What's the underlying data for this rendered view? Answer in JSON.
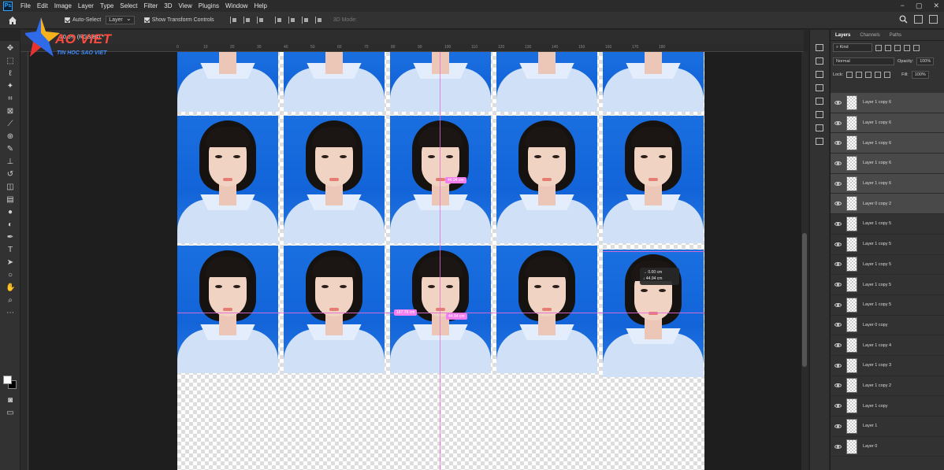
{
  "app": {
    "logo_letters": "Ps"
  },
  "menu": [
    "File",
    "Edit",
    "Image",
    "Layer",
    "Type",
    "Select",
    "Filter",
    "3D",
    "View",
    "Plugins",
    "Window",
    "Help"
  ],
  "window_controls": [
    "−",
    "▢",
    "✕"
  ],
  "options": {
    "auto_select_label": "Auto-Select",
    "auto_select_target": "Layer",
    "show_transform_label": "Show Transform Controls",
    "mode_3d_label": "3D Mode:"
  },
  "document": {
    "tab_title": "20.6% (RGB/8#) *"
  },
  "ruler_labels": [
    "0",
    "10",
    "20",
    "30",
    "40",
    "50",
    "60",
    "70",
    "80",
    "90",
    "100",
    "110",
    "120",
    "130",
    "140",
    "150",
    "160",
    "170",
    "180"
  ],
  "measurements": {
    "top": "44.94 cm",
    "left": "167.79 cm",
    "mid": "44.94 cm",
    "tooltip_dx": "0.00 cm",
    "tooltip_dy": "44.94 cm"
  },
  "logo": {
    "main": "AO VIET",
    "sub": "TIN HOC SAO VIET"
  },
  "layers_panel": {
    "tabs": [
      "Layers",
      "Channels",
      "Paths"
    ],
    "filter": "Kind",
    "blend_mode": "Normal",
    "opacity_label": "Opacity:",
    "opacity_value": "100%",
    "lock_label": "Lock:",
    "fill_label": "Fill:",
    "fill_value": "100%",
    "layers": [
      {
        "name": "Layer 1 copy 6",
        "selected": true
      },
      {
        "name": "Layer 1 copy 6",
        "selected": true
      },
      {
        "name": "Layer 1 copy 6",
        "selected": true
      },
      {
        "name": "Layer 1 copy 6",
        "selected": true
      },
      {
        "name": "Layer 1 copy 6",
        "selected": true
      },
      {
        "name": "Layer 0 copy 2",
        "selected": true
      },
      {
        "name": "Layer 1 copy 5",
        "selected": false
      },
      {
        "name": "Layer 1 copy 5",
        "selected": false
      },
      {
        "name": "Layer 1 copy 5",
        "selected": false
      },
      {
        "name": "Layer 1 copy 5",
        "selected": false
      },
      {
        "name": "Layer 1 copy 5",
        "selected": false
      },
      {
        "name": "Layer 0 copy",
        "selected": false
      },
      {
        "name": "Layer 1 copy 4",
        "selected": false
      },
      {
        "name": "Layer 1 copy 3",
        "selected": false
      },
      {
        "name": "Layer 1 copy 2",
        "selected": false
      },
      {
        "name": "Layer 1 copy",
        "selected": false
      },
      {
        "name": "Layer 1",
        "selected": false
      },
      {
        "name": "Layer 0",
        "selected": false
      }
    ]
  },
  "tools": [
    "move-icon",
    "marquee-icon",
    "lasso-icon",
    "magic-wand-icon",
    "crop-icon",
    "frame-icon",
    "eyedropper-icon",
    "healing-icon",
    "brush-icon",
    "stamp-icon",
    "history-brush-icon",
    "eraser-icon",
    "gradient-icon",
    "blur-icon",
    "dodge-icon",
    "pen-icon",
    "type-icon",
    "path-select-icon",
    "shape-icon",
    "hand-icon",
    "zoom-icon",
    "more-icon"
  ]
}
